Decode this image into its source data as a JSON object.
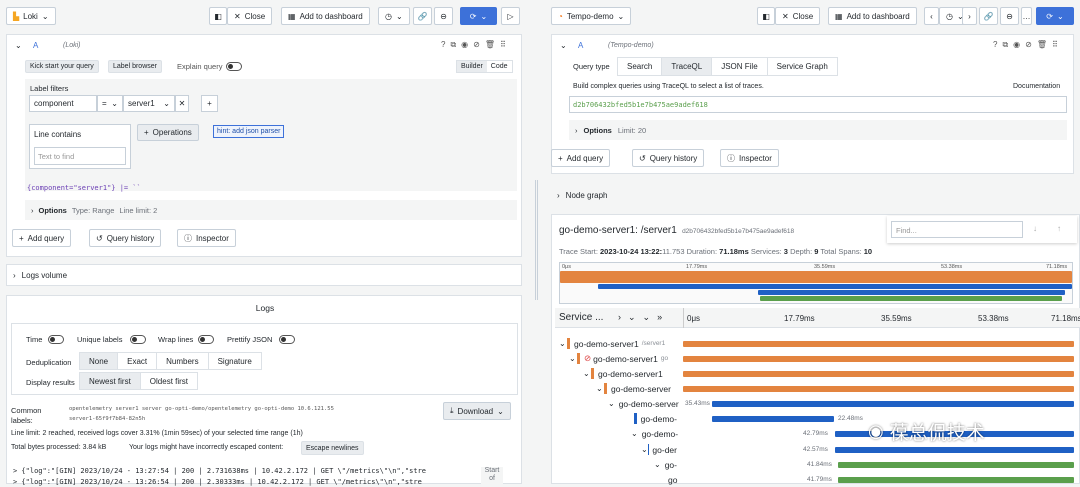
{
  "left": {
    "datasource": "Loki",
    "toolbar": {
      "close": "Close",
      "add_dashboard": "Add to dashboard"
    },
    "query": {
      "letter": "A",
      "source": "(Loki)",
      "kick_start": "Kick start your query",
      "label_browser": "Label browser",
      "explain": "Explain query",
      "builder": "Builder",
      "code": "Code",
      "label_filters": "Label filters",
      "label": "component",
      "op": "=",
      "value": "server1",
      "line_contains": "Line contains",
      "text_placeholder": "Text to find",
      "operations": "Operations",
      "hint": "hint: add json parser",
      "expr": "{component=\"server1\"} |= ``",
      "options": "Options",
      "opt_type": "Type: Range",
      "opt_limit": "Line limit: 2"
    },
    "buttons": {
      "add_query": "Add query",
      "history": "Query history",
      "inspector": "Inspector"
    },
    "logs_volume": "Logs volume",
    "logs": {
      "title": "Logs",
      "time": "Time",
      "unique": "Unique labels",
      "wrap": "Wrap lines",
      "pretty": "Prettify JSON",
      "dedup": "Deduplication",
      "dedup_opts": [
        "None",
        "Exact",
        "Numbers",
        "Signature"
      ],
      "display": "Display results",
      "display_opts": [
        "Newest first",
        "Oldest first"
      ],
      "common": "Common",
      "labels_word": "labels:",
      "common_labels": "opentelemetry server1 server go-opti-demo/opentelemetry go-opti-demo 10.6.121.55",
      "common_labels2": "server1-65f9f7b84-82n5h",
      "download": "Download",
      "line_limit": "Line limit: 2 reached, received logs cover 3.31% (1min 59sec) of your selected time range (1h)",
      "bytes": "Total bytes processed: 3.84 kB",
      "escape_msg": "Your logs might have incorrectly escaped content:",
      "escape": "Escape newlines",
      "lines": [
        "> {\"log\":\"[GIN] 2023/10/24 - 13:27:54 | 200 |     2.731638ms |     10.42.2.172 | GET      \\\"/metrics\\\"\\n\",\"stre",
        "> {\"log\":\"[GIN] 2023/10/24 - 13:26:54 | 200 |     2.30333ms |     10.42.2.172 | GET      \\\"/metrics\\\"\\n\",\"stre"
      ],
      "start": "Start",
      "of": "of"
    }
  },
  "right": {
    "datasource": "Tempo-demo",
    "toolbar": {
      "close": "Close",
      "add_dashboard": "Add to dashboard"
    },
    "query": {
      "letter": "A",
      "source": "(Tempo-demo)",
      "query_type": "Query type",
      "tabs": [
        "Search",
        "TraceQL",
        "JSON File",
        "Service Graph"
      ],
      "build_text": "Build complex queries using TraceQL to select a list of traces.",
      "documentation": "Documentation",
      "trace_id": "d2b706432bfed5b1e7b475ae9adef618",
      "options": "Options",
      "opt_limit": "Limit: 20"
    },
    "buttons": {
      "add_query": "Add query",
      "history": "Query history",
      "inspector": "Inspector"
    },
    "node_graph": "Node graph",
    "trace": {
      "title": "go-demo-server1: /server1",
      "id": "d2b706432bfed5b1e7b475ae9adef618",
      "find": "Find...",
      "start_label": "Trace Start:",
      "start": "2023-10-24 13:22:",
      "start_ms": "11.753",
      "duration_label": "Duration:",
      "duration": "71.18ms",
      "services_label": "Services:",
      "services": "3",
      "depth_label": "Depth:",
      "depth": "9",
      "spans_label": "Total Spans:",
      "spans": "10",
      "mini_ticks": [
        "0μs",
        "17.79ms",
        "35.59ms",
        "53.38ms",
        "71.18ms"
      ],
      "col_service": "Service ...",
      "ticks": [
        "0μs",
        "17.79ms",
        "35.59ms",
        "53.38ms",
        "71.18ms"
      ],
      "rows": [
        {
          "name": "go-demo-server1",
          "op": "/server1",
          "dur": ""
        },
        {
          "name": "go-demo-server1",
          "op": "go",
          "dur": ""
        },
        {
          "name": "go-demo-server1",
          "op": "",
          "dur": ""
        },
        {
          "name": "go-demo-server",
          "op": "",
          "dur": ""
        },
        {
          "name": "go-demo-server",
          "op": "",
          "dur": "35.43ms"
        },
        {
          "name": "go-demo-",
          "op": "",
          "dur": "22.48ms"
        },
        {
          "name": "go-demo-",
          "op": "",
          "dur": "42.79ms"
        },
        {
          "name": "go-der",
          "op": "",
          "dur": "42.57ms"
        },
        {
          "name": "go-",
          "op": "",
          "dur": "41.84ms"
        },
        {
          "name": "go",
          "op": "",
          "dur": "41.79ms"
        }
      ]
    },
    "watermark": "葆总侃技术"
  }
}
